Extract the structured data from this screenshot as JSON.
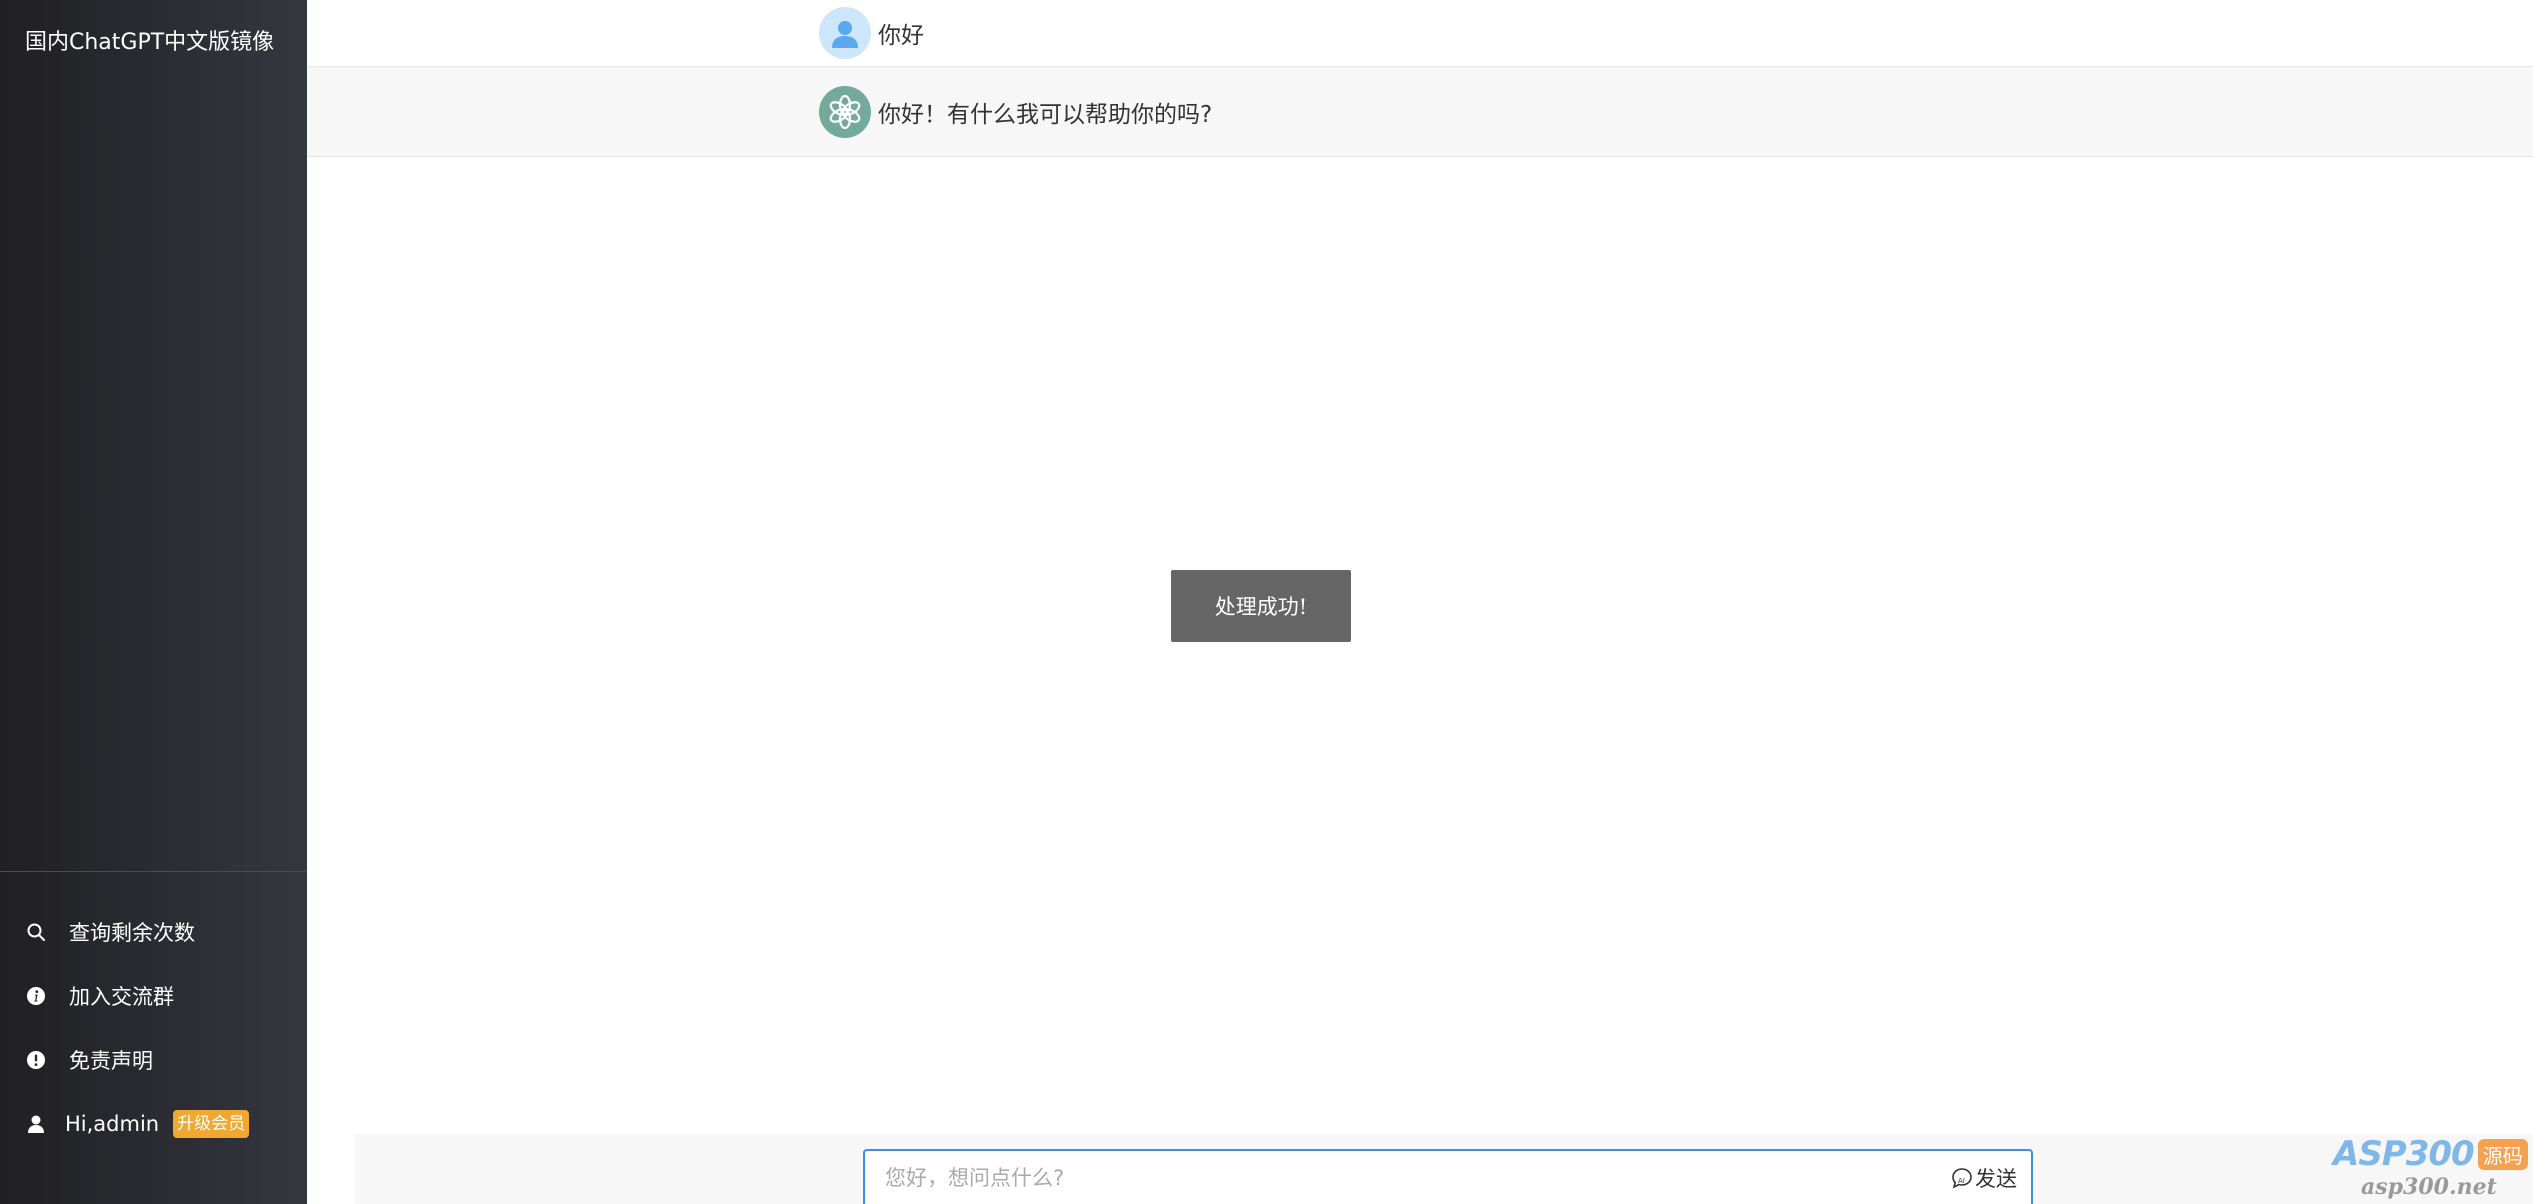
{
  "sidebar": {
    "title": "国内ChatGPT中文版镜像",
    "menu": [
      {
        "label": "查询剩余次数",
        "icon": "search-icon"
      },
      {
        "label": "加入交流群",
        "icon": "info-icon"
      },
      {
        "label": "免责声明",
        "icon": "alert-icon"
      }
    ],
    "user": {
      "greeting": "Hi,admin",
      "badge": "升级会员",
      "icon": "user-icon"
    }
  },
  "chat": {
    "messages": [
      {
        "role": "user",
        "text": "你好",
        "avatar": "user-avatar"
      },
      {
        "role": "assistant",
        "text": "你好！有什么我可以帮助你的吗?",
        "avatar": "openai-logo"
      }
    ]
  },
  "toast": {
    "text": "处理成功!"
  },
  "input": {
    "placeholder": "您好，想问点什么?",
    "value": "",
    "send_label": "发送"
  },
  "watermark": {
    "logo": "ASP300",
    "tag": "源码",
    "url": "asp300.net"
  },
  "colors": {
    "sidebar_bg_start": "#202023",
    "sidebar_bg_end": "#35373f",
    "accent": "#3b8ee0",
    "badge": "#f0a830",
    "bot_avatar": "#74aa9c",
    "toast_bg": "#666666"
  }
}
